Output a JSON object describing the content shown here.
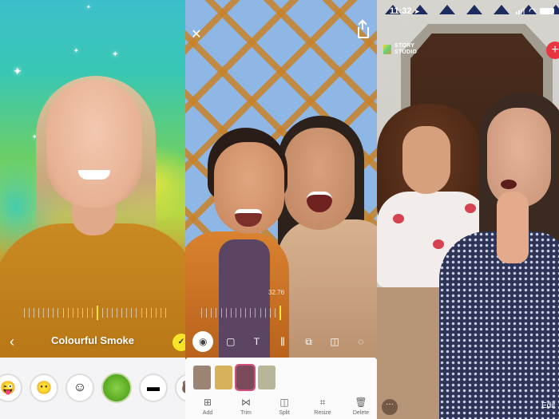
{
  "panel_lens": {
    "lens_name": "Colourful Smoke",
    "back_icon": "‹",
    "capture_icon": "✓",
    "lens_items": [
      {
        "name": "emoji-lens",
        "glyph": "😜"
      },
      {
        "name": "face-mask-lens",
        "glyph": "😶"
      },
      {
        "name": "cartoon-lens",
        "glyph": "☺"
      },
      {
        "name": "colourful-smoke-lens",
        "glyph": "",
        "selected": true
      },
      {
        "name": "glitch-lens",
        "glyph": "▬"
      },
      {
        "name": "bear-lens",
        "glyph": "🐻"
      }
    ],
    "accent_color": "#f7e426"
  },
  "panel_editor": {
    "close_icon": "✕",
    "timecode": "32.76",
    "tools": [
      {
        "name": "camera-roll",
        "glyph": "◉",
        "active": true
      },
      {
        "name": "sticker",
        "glyph": "▢"
      },
      {
        "name": "text",
        "glyph": "T"
      },
      {
        "name": "audio",
        "glyph": "⫼"
      },
      {
        "name": "overlay",
        "glyph": "⧉"
      },
      {
        "name": "filter",
        "glyph": "◫"
      },
      {
        "name": "more",
        "glyph": "◌"
      }
    ],
    "clips": [
      {
        "color": "#9a8474"
      },
      {
        "color": "#d8b25a"
      },
      {
        "color": "#7b4a5a",
        "selected": true
      },
      {
        "color": "#b7b59a"
      }
    ],
    "actions": [
      {
        "name": "add",
        "label": "Add",
        "glyph": "⊞"
      },
      {
        "name": "trim",
        "label": "Trim",
        "glyph": "⋈"
      },
      {
        "name": "split",
        "label": "Split",
        "glyph": "◫"
      },
      {
        "name": "resize",
        "label": "Resize",
        "glyph": "⌗"
      },
      {
        "name": "delete",
        "label": "Delete",
        "glyph": "🗑"
      }
    ]
  },
  "panel_story": {
    "status_time": "11:32",
    "location_icon": "➤",
    "brand_line1": "STORY",
    "brand_line2": "STUDIO",
    "plus_label": "+",
    "more_label": "···",
    "edit_label": "Edit",
    "plus_color": "#e8353f"
  }
}
